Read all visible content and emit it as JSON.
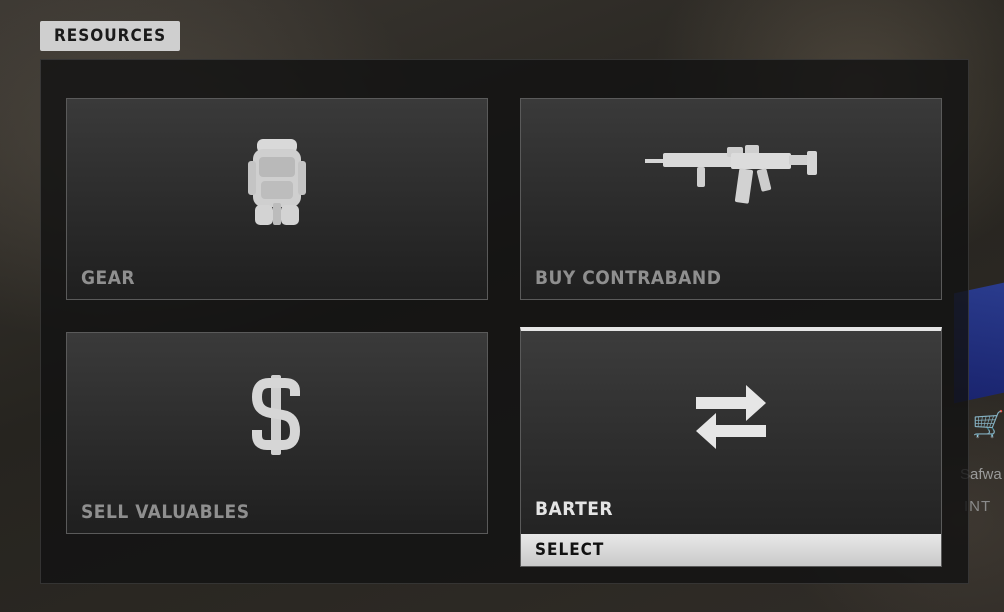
{
  "section": {
    "title": "RESOURCES"
  },
  "tiles": [
    {
      "label": "GEAR",
      "icon": "backpack-icon"
    },
    {
      "label": "BUY CONTRABAND",
      "icon": "rifle-icon"
    },
    {
      "label": "SELL VALUABLES",
      "icon": "dollar-icon"
    },
    {
      "label": "BARTER",
      "icon": "swap-arrows-icon",
      "selected": true,
      "action_label": "SELECT"
    }
  ],
  "background_peek": {
    "text": "Safwa",
    "subtext": "INT",
    "icon": "cart-icon"
  },
  "colors": {
    "selected_label": "#e4e4e4",
    "unselected_label": "#8f8f8f",
    "select_bar": "#d6d6d6"
  }
}
